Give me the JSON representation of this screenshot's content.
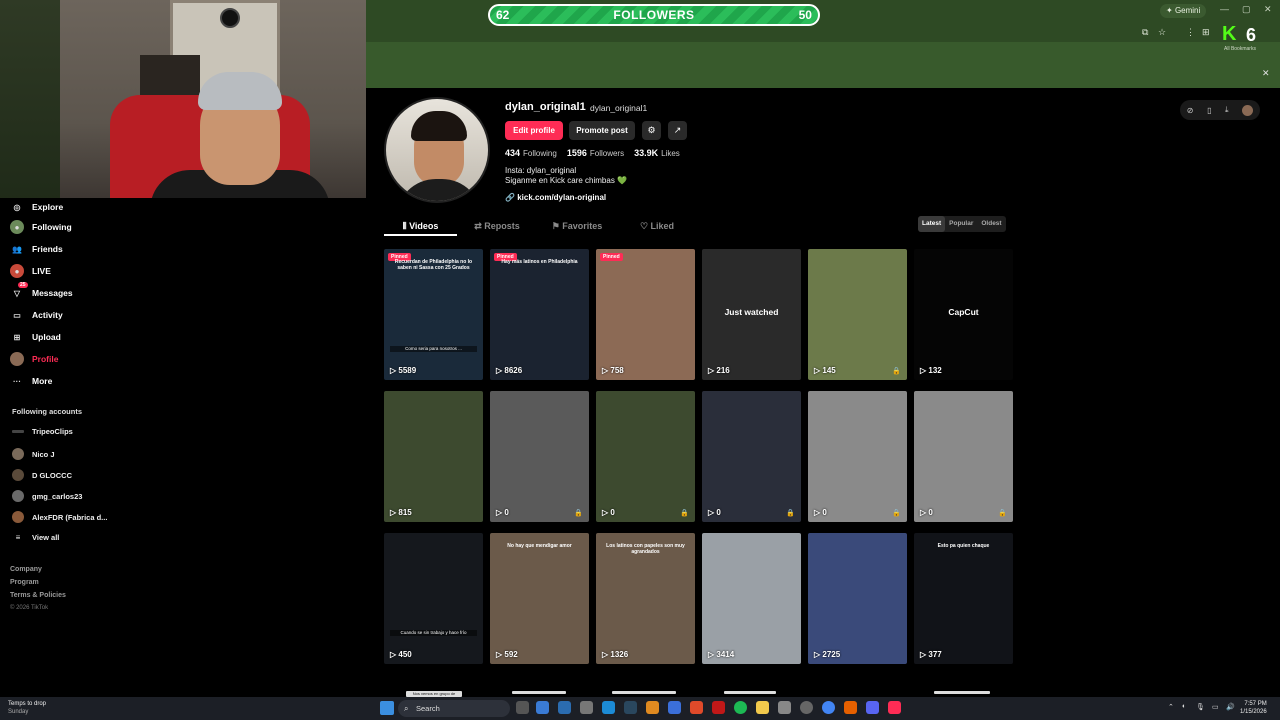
{
  "followers_bar": {
    "left": "62",
    "label": "FOLLOWERS",
    "right": "50"
  },
  "browser": {
    "gemini": "Gemini",
    "k_number": "6",
    "bookmarks": "All Bookmarks"
  },
  "sidebar": {
    "items": [
      {
        "label": "Explore",
        "icon": "compass-icon"
      },
      {
        "label": "Following",
        "icon": "following-icon"
      },
      {
        "label": "Friends",
        "icon": "friends-icon"
      },
      {
        "label": "LIVE",
        "icon": "live-icon"
      },
      {
        "label": "Messages",
        "icon": "messages-icon",
        "badge": "25"
      },
      {
        "label": "Activity",
        "icon": "activity-icon"
      },
      {
        "label": "Upload",
        "icon": "upload-icon"
      },
      {
        "label": "Profile",
        "icon": "profile-icon",
        "active": true
      },
      {
        "label": "More",
        "icon": "more-icon"
      }
    ],
    "following_header": "Following accounts",
    "accounts": [
      "TripeoClips",
      "Nico J",
      "D GLOCCC",
      "gmg_carlos23",
      "AlexFDR (Fabrica d...",
      "View all"
    ],
    "footer": [
      "Company",
      "Program",
      "Terms & Policies"
    ],
    "copyright": "© 2026 TikTok"
  },
  "profile": {
    "username": "dylan_original1",
    "nickname": "dylan_original1",
    "edit_button": "Edit profile",
    "promote_button": "Promote post",
    "stats": [
      {
        "value": "434",
        "label": "Following"
      },
      {
        "value": "1596",
        "label": "Followers"
      },
      {
        "value": "33.9K",
        "label": "Likes"
      }
    ],
    "bio_line1": "Insta: dylan_original",
    "bio_line2": "Siganme en Kick care chimbas 💚",
    "link": "kick.com/dylan-original"
  },
  "tabs": [
    "Videos",
    "Reposts",
    "Favorites",
    "Liked"
  ],
  "sort": [
    "Latest",
    "Popular",
    "Oldest"
  ],
  "videos": [
    {
      "count": "5589",
      "pinned": "Pinned",
      "caption": "Recuerdan de Philadelphia no lo saben ni Sassa con 25 Grados",
      "caption2": "Como seria para nosotros ...",
      "bg": "#1a2a3a"
    },
    {
      "count": "8626",
      "pinned": "Pinned",
      "caption": "Hay más latinos en Philadelphia",
      "bg": "#1b2330"
    },
    {
      "count": "758",
      "pinned": "Pinned",
      "bg": "#8c6a55"
    },
    {
      "count": "216",
      "center": "Just watched",
      "bg": "#2a2a2a"
    },
    {
      "count": "145",
      "lock": true,
      "bg": "#6c7a4a"
    },
    {
      "count": "132",
      "center": "CapCut",
      "bg": "#050505"
    },
    {
      "count": "815",
      "bg": "#3d4a2f"
    },
    {
      "count": "0",
      "lock": true,
      "bg": "#5a5a5a"
    },
    {
      "count": "0",
      "lock": true,
      "bg": "#3d4a2f"
    },
    {
      "count": "0",
      "lock": true,
      "bg": "#2a2e3a"
    },
    {
      "count": "0",
      "lock": true,
      "bg": "#8a8a8a"
    },
    {
      "count": "0",
      "lock": true,
      "bg": "#8a8a8a"
    },
    {
      "count": "450",
      "caption2": "Cuando se sin trabajo y hace frío",
      "bg": "#15181d"
    },
    {
      "count": "592",
      "caption": "No hay que mendigar amor",
      "bg": "#6b5a4a"
    },
    {
      "count": "1326",
      "caption": "Los latinos con papeles son muy agrandados",
      "bg": "#6b5a4a"
    },
    {
      "count": "3414",
      "bg": "#9aa0a6"
    },
    {
      "count": "2725",
      "bg": "#3a4a7a"
    },
    {
      "count": "377",
      "caption": "Esto pa quien chaque",
      "bg": "#111318"
    }
  ],
  "peek_caption": "Nos vemos en grupo de",
  "taskbar": {
    "weather_title": "Temps to drop",
    "weather_sub": "Sunday",
    "search": "Search",
    "time": "7:57 PM",
    "date": "1/15/2026"
  }
}
